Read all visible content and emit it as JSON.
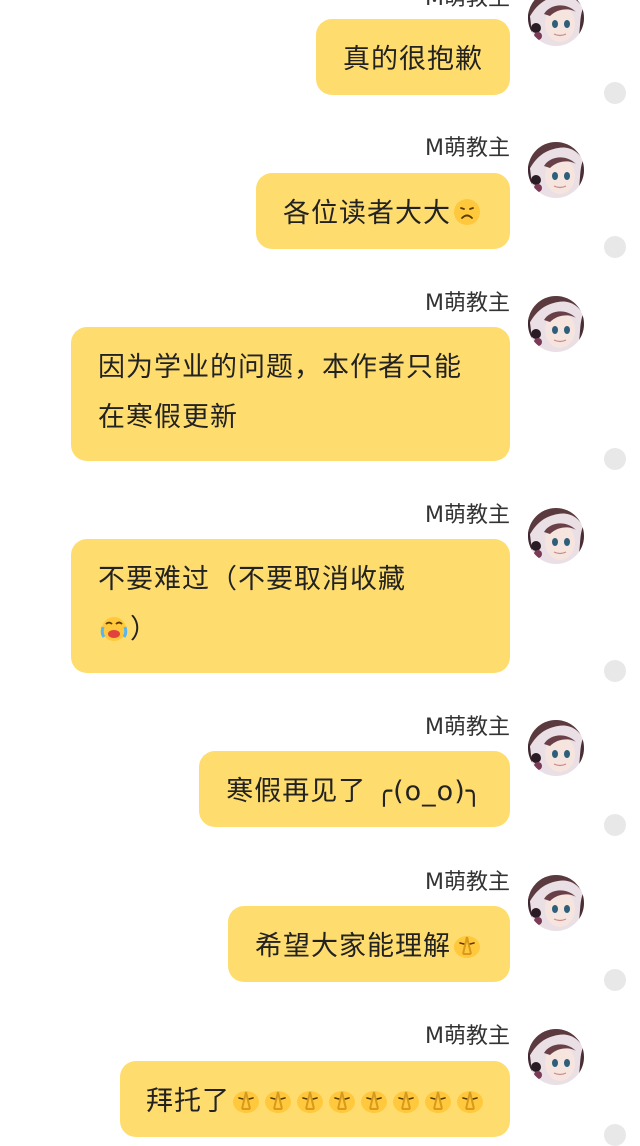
{
  "sender_name": "M萌教主",
  "messages": [
    {
      "text": "真的很抱歉"
    },
    {
      "text": "各位读者大大"
    },
    {
      "text": "因为学业的问题，本作者只能在寒假更新"
    },
    {
      "text": "不要难过（不要取消收藏",
      "text_after": "）"
    },
    {
      "text": "寒假再见了 ╭(o_o)╮"
    },
    {
      "text": "希望大家能理解"
    },
    {
      "text": "拜托了"
    }
  ],
  "emoji_names": [
    "sad-face-icon",
    "crying-face-icon",
    "praying-hands-icon"
  ],
  "colors": {
    "bubble": "#fedd6e",
    "background": "#ffffff",
    "status_dot": "#e8e8e8"
  }
}
